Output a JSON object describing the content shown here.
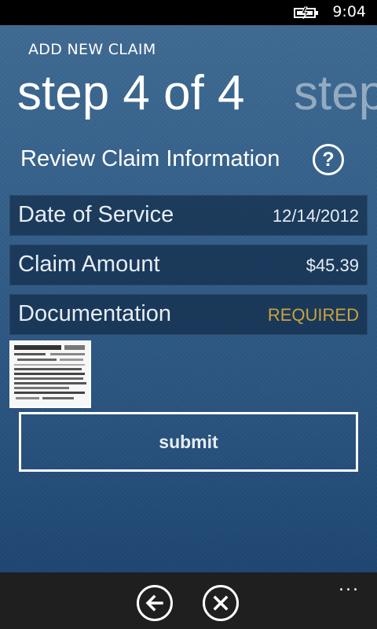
{
  "status": {
    "time": "9:04",
    "battery_icon": "battery-charging-icon"
  },
  "header": {
    "app_title": "ADD NEW CLAIM",
    "pivot_current": "step 4 of 4",
    "pivot_next": "step"
  },
  "section": {
    "title": "Review Claim Information",
    "help_label": "?"
  },
  "rows": [
    {
      "label": "Date of Service",
      "value": "12/14/2012"
    },
    {
      "label": "Claim Amount",
      "value": "$45.39"
    },
    {
      "label": "Documentation",
      "value": "REQUIRED"
    }
  ],
  "colors": {
    "required": "#c9a33e",
    "appbar": "#1f1f1f"
  },
  "actions": {
    "submit_label": "submit",
    "back_icon": "back-arrow-icon",
    "cancel_icon": "close-icon",
    "more_label": "..."
  }
}
